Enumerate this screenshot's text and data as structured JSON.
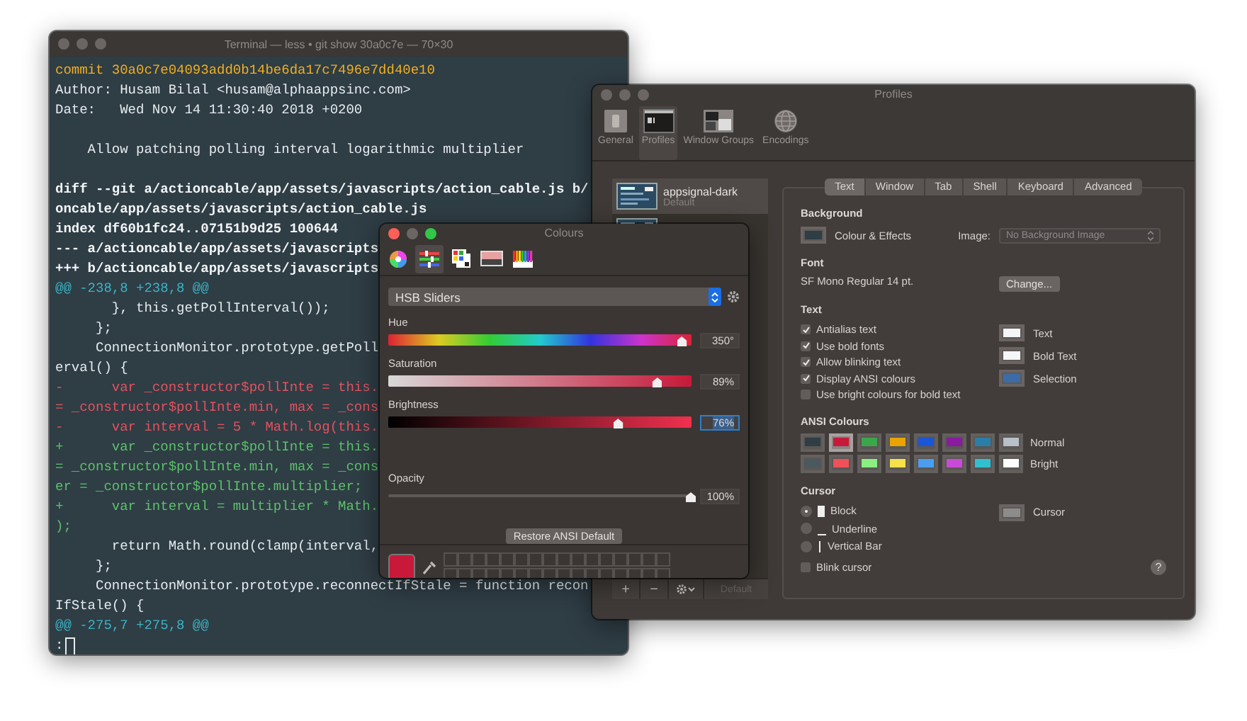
{
  "terminal": {
    "title": "Terminal — less • git show 30a0c7e — 70×30",
    "active": false,
    "cursor": true,
    "lines": [
      {
        "text": "commit 30a0c7e04093add0b14be6da17c7496e7dd40e10",
        "kind": "commit"
      },
      {
        "text": "Author: Husam Bilal <husam@alphaappsinc.com>",
        "kind": "plain"
      },
      {
        "text": "Date:   Wed Nov 14 11:30:40 2018 +0200",
        "kind": "plain"
      },
      {
        "kind": "plain"
      },
      {
        "text": "    Allow patching polling interval logarithmic multiplier",
        "kind": "plain"
      },
      {
        "kind": "plain"
      },
      {
        "text": "diff --git a/actioncable/app/assets/javascripts/action_cable.js b/",
        "kind": "bold"
      },
      {
        "text": "oncable/app/assets/javascripts/action_cable.js",
        "kind": "bold"
      },
      {
        "text": "index df60b1fc24..07151b9d25 100644",
        "kind": "bold"
      },
      {
        "text": "--- a/actioncable/app/assets/javascripts",
        "kind": "bold"
      },
      {
        "text": "+++ b/actioncable/app/assets/javascripts",
        "kind": "bold"
      },
      {
        "text": "@@ -238,8 +238,8 @@",
        "kind": "hunk"
      },
      {
        "text": "       }, this.getPollInterval());",
        "kind": "plain"
      },
      {
        "text": "     };",
        "kind": "plain"
      },
      {
        "text": "     ConnectionMonitor.prototype.getPoll",
        "kind": "plain"
      },
      {
        "text": "erval() {",
        "kind": "plain"
      },
      {
        "text": "-      var _constructor$pollInte = this.",
        "kind": "removed"
      },
      {
        "text": "= _constructor$pollInte.min, max = _cons",
        "kind": "removed"
      },
      {
        "text": "-      var interval = 5 * Math.log(this.",
        "kind": "removed"
      },
      {
        "text": "+      var _constructor$pollInte = this.",
        "kind": "added"
      },
      {
        "text": "= _constructor$pollInte.min, max = _cons",
        "kind": "added"
      },
      {
        "text": "er = _constructor$pollInte.multiplier;",
        "kind": "added"
      },
      {
        "text": "+      var interval = multiplier * Math.",
        "kind": "added"
      },
      {
        "text": ");",
        "kind": "added"
      },
      {
        "text": "       return Math.round(clamp(interval,",
        "kind": "plain"
      },
      {
        "text": "     };",
        "kind": "plain"
      },
      {
        "text": "     ConnectionMonitor.prototype.reconnectIfStale = function recon",
        "kind": "plain"
      },
      {
        "text": "IfStale() {",
        "kind": "plain"
      },
      {
        "text": "@@ -275,7 +275,8 @@",
        "kind": "hunk"
      },
      {
        "text": ":",
        "kind": "plain"
      }
    ]
  },
  "profiles": {
    "title": "Profiles",
    "active": false,
    "toolbar": [
      {
        "label": "General",
        "kind": "general",
        "selected": false
      },
      {
        "label": "Profiles",
        "kind": "profiles",
        "selected": true
      },
      {
        "label": "Window Groups",
        "kind": "groups",
        "selected": false
      },
      {
        "label": "Encodings",
        "kind": "encodings",
        "selected": false
      }
    ],
    "profile_list": [
      {
        "name": "appsignal-dark",
        "subtitle": "Default",
        "selected": true
      }
    ],
    "list_buttons": {
      "add": "+",
      "remove": "−",
      "default_button": {
        "label": "Default",
        "disabled": true
      }
    },
    "tabs": [
      {
        "label": "Text",
        "selected": true
      },
      {
        "label": "Window",
        "selected": false
      },
      {
        "label": "Tab",
        "selected": false
      },
      {
        "label": "Shell",
        "selected": false
      },
      {
        "label": "Keyboard",
        "selected": false
      },
      {
        "label": "Advanced",
        "selected": false
      }
    ],
    "background": {
      "heading": "Background",
      "swatch_label": "Colour & Effects",
      "image_label": "Image:",
      "image_value": "No Background Image"
    },
    "font": {
      "heading": "Font",
      "value": "SF Mono Regular 14 pt.",
      "button": "Change..."
    },
    "text": {
      "heading": "Text",
      "checkboxes": [
        {
          "label": "Antialias text",
          "checked": true
        },
        {
          "label": "Use bold fonts",
          "checked": true
        },
        {
          "label": "Allow blinking text",
          "checked": true
        },
        {
          "label": "Display ANSI colours",
          "checked": true
        },
        {
          "label": "Use bright colours for bold text",
          "checked": false
        }
      ],
      "swatches": [
        {
          "label": "Text",
          "color": "#f4f6f8"
        },
        {
          "label": "Bold Text",
          "color": "#f4f6f8"
        },
        {
          "label": "Selection",
          "color": "#3c6ca8"
        }
      ]
    },
    "ansi": {
      "heading": "ANSI Colours",
      "rows": [
        {
          "label": "Normal",
          "colors": [
            {
              "color": "#2f3d45",
              "selected": false
            },
            {
              "color": "#c8193a",
              "selected": true
            },
            {
              "color": "#3aa84a",
              "selected": false
            },
            {
              "color": "#e9a400",
              "selected": false
            },
            {
              "color": "#1a56d6",
              "selected": false
            },
            {
              "color": "#8a1aa0",
              "selected": false
            },
            {
              "color": "#2a7fa8",
              "selected": false
            },
            {
              "color": "#b8c0c8",
              "selected": false
            }
          ]
        },
        {
          "label": "Bright",
          "colors": [
            {
              "color": "#4a5860",
              "selected": false
            },
            {
              "color": "#f0505a",
              "selected": false
            },
            {
              "color": "#8aef80",
              "selected": false
            },
            {
              "color": "#f5e14a",
              "selected": false
            },
            {
              "color": "#4a9ef0",
              "selected": false
            },
            {
              "color": "#c84ad8",
              "selected": false
            },
            {
              "color": "#30c0d0",
              "selected": false
            },
            {
              "color": "#ffffff",
              "selected": false
            }
          ]
        }
      ]
    },
    "cursor": {
      "heading": "Cursor",
      "options": [
        {
          "label": "Block",
          "kind": "block",
          "selected": true
        },
        {
          "label": "Underline",
          "kind": "underline",
          "selected": false
        },
        {
          "label": "Vertical Bar",
          "kind": "bar",
          "selected": false
        }
      ],
      "swatch_label": "Cursor",
      "blink": {
        "label": "Blink cursor",
        "checked": false
      }
    },
    "help": "?"
  },
  "colours": {
    "title": "Colours",
    "active": true,
    "modes": [
      {
        "kind": "wheel",
        "selected": false
      },
      {
        "kind": "sliders",
        "selected": true
      },
      {
        "kind": "palettes",
        "selected": false
      },
      {
        "kind": "image",
        "selected": false
      },
      {
        "kind": "pencils",
        "selected": false
      }
    ],
    "picker": "HSB Sliders",
    "sliders": [
      {
        "label": "Hue",
        "kind": "hue",
        "level": 0.97,
        "value": "350°",
        "focused": false
      },
      {
        "label": "Saturation",
        "kind": "saturation",
        "level": 0.89,
        "value": "89%",
        "focused": false
      },
      {
        "label": "Brightness",
        "kind": "brightness",
        "level": 0.76,
        "value": "76%",
        "focused": true
      },
      {
        "label": "Opacity",
        "kind": "opacity",
        "level": 1,
        "value": "100%",
        "focused": false
      }
    ],
    "restore_button": "Restore ANSI Default"
  }
}
